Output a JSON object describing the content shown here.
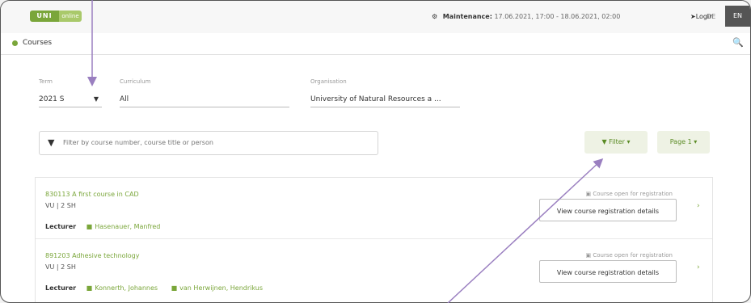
{
  "header": {
    "logo_left": "UNI",
    "logo_right": "online",
    "maintenance_label": "Maintenance:",
    "maintenance_dates": "17.06.2021, 17:00 - 18.06.2021, 02:00",
    "login": "Login",
    "lang_de": "DE",
    "lang_en": "EN"
  },
  "subheader": {
    "title": "Courses"
  },
  "filters": {
    "term_label": "Term",
    "term_value": "2021 S",
    "curriculum_label": "Curriculum",
    "curriculum_value": "All",
    "organisation_label": "Organisation",
    "organisation_value": "University of Natural Resources a ...",
    "search_placeholder": "Filter by course number, course title or person",
    "filter_button": "Filter",
    "page_button": "Page 1"
  },
  "courses": [
    {
      "title": "830113 A first course in CAD",
      "hours": "VU | 2 SH",
      "status": "Course open for registration",
      "lecturer_label": "Lecturer",
      "lecturers": [
        "Hasenauer, Manfred"
      ],
      "button": "View course registration details"
    },
    {
      "title": "891203 Adhesive technology",
      "hours": "VU | 2 SH",
      "status": "Course open for registration",
      "lecturer_label": "Lecturer",
      "lecturers": [
        "Konnerth, Johannes",
        "van Herwijnen, Hendrikus"
      ],
      "button": "View course registration details"
    }
  ],
  "colors": {
    "accent": "#7aa63a",
    "arrow": "#9a7fc0"
  }
}
